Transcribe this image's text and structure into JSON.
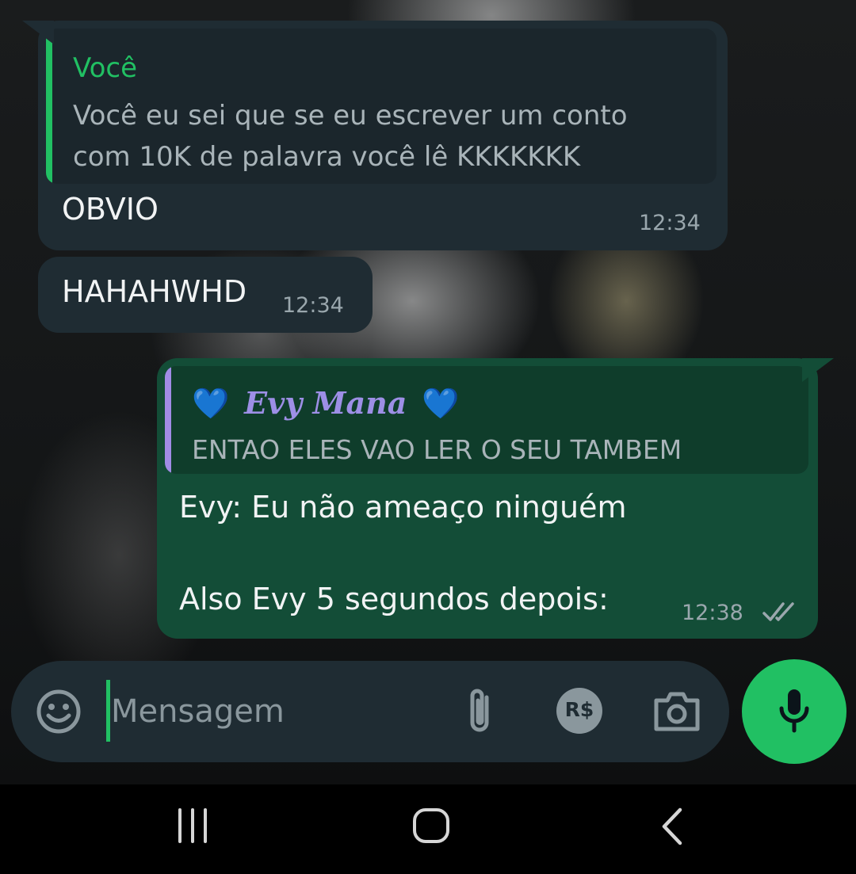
{
  "messages": [
    {
      "direction": "incoming",
      "quoted": {
        "author": "Você",
        "author_color": "#21c063",
        "bar_color": "#21c063",
        "line1": "Você eu sei que se eu escrever um conto",
        "line2": "com 10K de palavra você lê KKKKKKK"
      },
      "text": "OBVIO",
      "time": "12:34"
    },
    {
      "direction": "incoming",
      "text": "HAHAHWHD",
      "time": "12:34"
    },
    {
      "direction": "outgoing",
      "quoted": {
        "emoji_left": "💙",
        "author": "Evy Mana",
        "emoji_right": "💙",
        "author_color": "#9d8fe6",
        "bar_color": "#a18ce6",
        "line1": "ENTAO ELES VAO LER O SEU TAMBEM"
      },
      "line1": "Evy: Eu não ameaço ninguém",
      "line2": "Also Evy 5 segundos depois:",
      "time": "12:38",
      "status_icon": "double-check-icon",
      "status_color": "#9aa7ad"
    }
  ],
  "composer": {
    "placeholder": "Mensagem",
    "emoji_icon": "emoji-icon",
    "attach_icon": "paperclip-icon",
    "payment_label": "R$",
    "camera_icon": "camera-icon",
    "mic_icon": "mic-icon",
    "accent_color": "#21c063"
  },
  "navigation": {
    "recents_icon": "recents-icon",
    "home_icon": "home-icon",
    "back_icon": "back-icon"
  }
}
